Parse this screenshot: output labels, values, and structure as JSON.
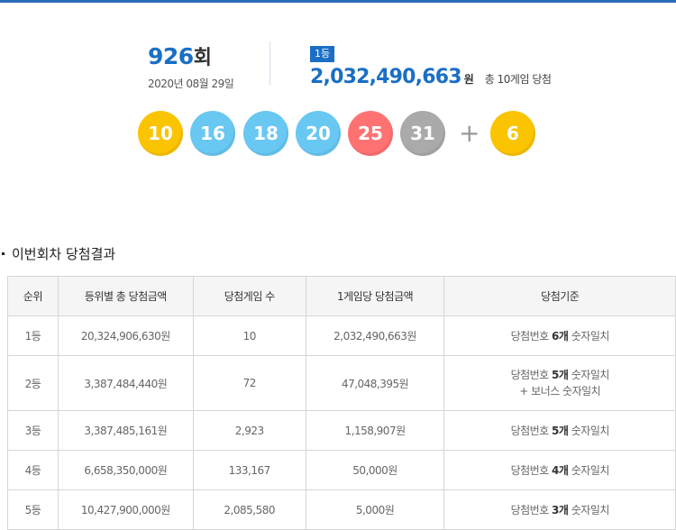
{
  "round": {
    "number": "926",
    "suffix": "회",
    "date": "2020년 08월 29일"
  },
  "first_prize": {
    "badge": "1등",
    "amount": "2,032,490,663",
    "unit": "원",
    "games": "총 10게임 당첨"
  },
  "balls": [
    {
      "value": "10",
      "color": "#fbc400"
    },
    {
      "value": "16",
      "color": "#69c8f2"
    },
    {
      "value": "18",
      "color": "#69c8f2"
    },
    {
      "value": "20",
      "color": "#69c8f2"
    },
    {
      "value": "25",
      "color": "#ff7272"
    },
    {
      "value": "31",
      "color": "#aaaaaa"
    }
  ],
  "plus_sign": "+",
  "bonus_ball": {
    "value": "6",
    "color": "#fbc400"
  },
  "section_title": "이번회차 당첨결과",
  "table": {
    "headers": [
      "순위",
      "등위별 총 당첨금액",
      "당첨게임 수",
      "1게임당 당첨금액",
      "당첨기준"
    ],
    "rows": [
      {
        "rank": "1등",
        "total": "20,324,906,630원",
        "games": "10",
        "per_game": "2,032,490,663원",
        "criteria": {
          "prefix": "당첨번호 ",
          "count": "6개",
          "suffix": " 숫자일치",
          "extra": ""
        }
      },
      {
        "rank": "2등",
        "total": "3,387,484,440원",
        "games": "72",
        "per_game": "47,048,395원",
        "criteria": {
          "prefix": "당첨번호 ",
          "count": "5개",
          "suffix": " 숫자일치",
          "extra": "+ 보너스 숫자일치"
        }
      },
      {
        "rank": "3등",
        "total": "3,387,485,161원",
        "games": "2,923",
        "per_game": "1,158,907원",
        "criteria": {
          "prefix": "당첨번호 ",
          "count": "5개",
          "suffix": " 숫자일치",
          "extra": ""
        }
      },
      {
        "rank": "4등",
        "total": "6,658,350,000원",
        "games": "133,167",
        "per_game": "50,000원",
        "criteria": {
          "prefix": "당첨번호 ",
          "count": "4개",
          "suffix": " 숫자일치",
          "extra": ""
        }
      },
      {
        "rank": "5등",
        "total": "10,427,900,000원",
        "games": "2,085,580",
        "per_game": "5,000원",
        "criteria": {
          "prefix": "당첨번호 ",
          "count": "3개",
          "suffix": " 숫자일치",
          "extra": ""
        }
      }
    ]
  }
}
